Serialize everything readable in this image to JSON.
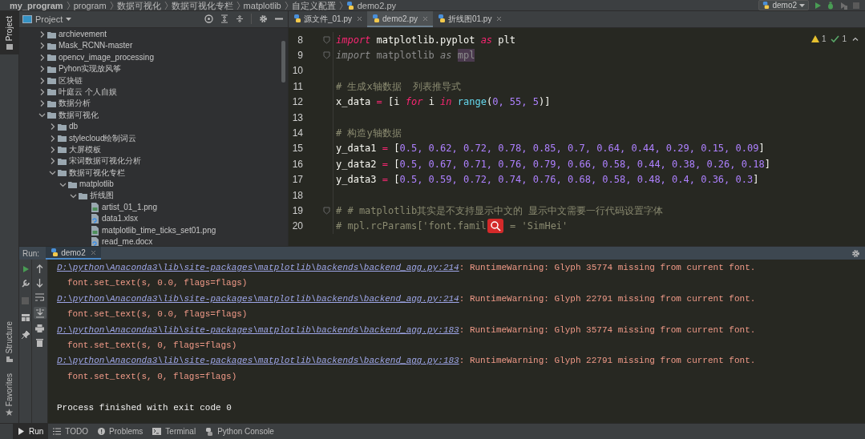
{
  "breadcrumbs": [
    {
      "text": "my_program",
      "bold": true
    },
    {
      "text": "program",
      "bold": false
    },
    {
      "text": "数据可视化",
      "bold": false
    },
    {
      "text": "数据可视化专栏",
      "bold": false
    },
    {
      "text": "matplotlib",
      "bold": false
    },
    {
      "text": "自定义配置",
      "bold": false
    },
    {
      "text": "demo2.py",
      "bold": false,
      "kind": "file"
    }
  ],
  "run_config": "demo2",
  "left_strip": [
    {
      "label": "Project",
      "selected": true
    }
  ],
  "left_strip_bottom": [
    {
      "label": "Structure"
    },
    {
      "label": "Favorites"
    }
  ],
  "project_panel": {
    "title": "Project",
    "tree": [
      {
        "name": "archievement",
        "kind": "folder",
        "expanded": false
      },
      {
        "name": "Mask_RCNN-master",
        "kind": "folder",
        "expanded": false
      },
      {
        "name": "opencv_image_processing",
        "kind": "folder",
        "expanded": false
      },
      {
        "name": "Pyhon实现放风筝",
        "kind": "folder",
        "expanded": false
      },
      {
        "name": "区块链",
        "kind": "folder",
        "expanded": false
      },
      {
        "name": "叶庭云  个人自娱",
        "kind": "folder",
        "expanded": false
      },
      {
        "name": "数据分析",
        "kind": "folder",
        "expanded": false
      },
      {
        "name": "数据可视化",
        "kind": "folder",
        "expanded": true,
        "children": [
          {
            "name": "db",
            "kind": "folder",
            "expanded": false
          },
          {
            "name": "stylecloud绘制词云",
            "kind": "folder",
            "expanded": false
          },
          {
            "name": "大屏模板",
            "kind": "folder",
            "expanded": false
          },
          {
            "name": "宋词数据可视化分析",
            "kind": "folder",
            "expanded": false
          },
          {
            "name": "数据可视化专栏",
            "kind": "folder",
            "expanded": true,
            "children": [
              {
                "name": "matplotlib",
                "kind": "folder",
                "expanded": true,
                "children": [
                  {
                    "name": "折线图",
                    "kind": "folder",
                    "expanded": true,
                    "children": [
                      {
                        "name": "artist_01_1.png",
                        "kind": "image"
                      },
                      {
                        "name": "data1.xlsx",
                        "kind": "unknown"
                      },
                      {
                        "name": "matplotlib_time_ticks_set01.png",
                        "kind": "image"
                      },
                      {
                        "name": "read_me.docx",
                        "kind": "unknown"
                      }
                    ]
                  }
                ]
              }
            ]
          }
        ]
      }
    ]
  },
  "editor": {
    "tabs": [
      {
        "label": "源文件_01.py",
        "selected": false
      },
      {
        "label": "demo2.py",
        "selected": true
      },
      {
        "label": "折线图01.py",
        "selected": false
      }
    ],
    "inspections": {
      "warnings": "1",
      "weak_warnings": "1"
    },
    "lines": [
      {
        "number": "8",
        "fold": true,
        "segments": [
          {
            "kind": "keyword",
            "text": "import"
          },
          {
            "kind": "plain",
            "text": " matplotlib.pyplot "
          },
          {
            "kind": "keyword",
            "text": "as"
          },
          {
            "kind": "plain",
            "text": " plt"
          }
        ]
      },
      {
        "number": "9",
        "fold": true,
        "segments": [
          {
            "kind": "unused_keyword",
            "text": "import"
          },
          {
            "kind": "unused",
            "text": " matplotlib "
          },
          {
            "kind": "unused_keyword",
            "text": "as "
          },
          {
            "kind": "highlight",
            "text": "mpl"
          }
        ]
      },
      {
        "number": "10",
        "fold": false
      },
      {
        "number": "11",
        "fold": false,
        "segments": [
          {
            "kind": "comment",
            "text": "# 生成x轴数据  列表推导式"
          }
        ]
      },
      {
        "number": "12",
        "fold": false,
        "segments": [
          {
            "kind": "plain",
            "text": "x_data"
          },
          {
            "kind": "op",
            "text": " = "
          },
          {
            "kind": "plain",
            "text": "[i "
          },
          {
            "kind": "keyword",
            "text": "for"
          },
          {
            "kind": "plain",
            "text": " i "
          },
          {
            "kind": "keyword",
            "text": "in "
          },
          {
            "kind": "builtin",
            "text": "range"
          },
          {
            "kind": "plain",
            "text": "("
          },
          {
            "kind": "number",
            "text": "0, 55, 5"
          },
          {
            "kind": "plain",
            "text": ")]"
          }
        ]
      },
      {
        "number": "13",
        "fold": false
      },
      {
        "number": "14",
        "fold": false,
        "segments": [
          {
            "kind": "comment",
            "text": "# 构造y轴数据"
          }
        ]
      },
      {
        "number": "15",
        "fold": false,
        "segments": [
          {
            "kind": "plain",
            "text": "y_data1"
          },
          {
            "kind": "op",
            "text": " = "
          },
          {
            "kind": "plain",
            "text": "["
          },
          {
            "kind": "number",
            "text": "0.5, 0.62, 0.72, 0.78, 0.85, 0.7, 0.64, 0.44, 0.29, 0.15, 0.09"
          },
          {
            "kind": "plain",
            "text": "]"
          }
        ]
      },
      {
        "number": "16",
        "fold": false,
        "segments": [
          {
            "kind": "plain",
            "text": "y_data2"
          },
          {
            "kind": "op",
            "text": " = "
          },
          {
            "kind": "plain",
            "text": "["
          },
          {
            "kind": "number",
            "text": "0.5, 0.67, 0.71, 0.76, 0.79, 0.66, 0.58, 0.44, 0.38, 0.26, 0.18"
          },
          {
            "kind": "plain",
            "text": "]"
          }
        ]
      },
      {
        "number": "17",
        "fold": false,
        "segments": [
          {
            "kind": "plain",
            "text": "y_data3"
          },
          {
            "kind": "op",
            "text": " = "
          },
          {
            "kind": "plain",
            "text": "["
          },
          {
            "kind": "number",
            "text": "0.5, 0.59, 0.72, 0.74, 0.76, 0.68, 0.58, 0.48, 0.4, 0.36, 0.3"
          },
          {
            "kind": "plain",
            "text": "]"
          }
        ]
      },
      {
        "number": "18",
        "fold": false
      },
      {
        "number": "19",
        "fold": true,
        "segments": [
          {
            "kind": "comment",
            "text": "# # matplotlib其实是不支持显示中文的 显示中文需要一行代码设置字体"
          }
        ]
      },
      {
        "number": "20",
        "fold": false,
        "segments": [
          {
            "kind": "comment",
            "text": "# mpl.rcParams['font.famil"
          },
          {
            "kind": "badge"
          },
          {
            "kind": "comment",
            "text": " = 'SimHei'"
          }
        ]
      }
    ]
  },
  "run_panel": {
    "label": "Run:",
    "tabs": [
      {
        "label": "demo2",
        "selected": true
      }
    ],
    "output": [
      {
        "kind": "link",
        "path": "D:\\python\\Anaconda3\\lib\\site-packages\\matplotlib\\backends\\backend_agg.py:214",
        "message": ": RuntimeWarning: Glyph 35774 missing from current font."
      },
      {
        "kind": "trace",
        "text": "font.set_text(s, 0.0, flags=flags)"
      },
      {
        "kind": "link",
        "path": "D:\\python\\Anaconda3\\lib\\site-packages\\matplotlib\\backends\\backend_agg.py:214",
        "message": ": RuntimeWarning: Glyph 22791 missing from current font."
      },
      {
        "kind": "trace",
        "text": "font.set_text(s, 0.0, flags=flags)"
      },
      {
        "kind": "link",
        "path": "D:\\python\\Anaconda3\\lib\\site-packages\\matplotlib\\backends\\backend_agg.py:183",
        "message": ": RuntimeWarning: Glyph 35774 missing from current font."
      },
      {
        "kind": "trace",
        "text": "font.set_text(s, 0, flags=flags)"
      },
      {
        "kind": "link",
        "path": "D:\\python\\Anaconda3\\lib\\site-packages\\matplotlib\\backends\\backend_agg.py:183",
        "message": ": RuntimeWarning: Glyph 22791 missing from current font."
      },
      {
        "kind": "trace",
        "text": "font.set_text(s, 0, flags=flags)"
      },
      {
        "kind": "process",
        "text": "Process finished with exit code 0"
      }
    ]
  },
  "bottom_tabs": [
    {
      "label": "Run",
      "selected": true
    },
    {
      "label": "TODO",
      "selected": false
    },
    {
      "label": "Problems",
      "selected": false
    },
    {
      "label": "Terminal",
      "selected": false
    },
    {
      "label": "Python Console",
      "selected": false
    }
  ]
}
